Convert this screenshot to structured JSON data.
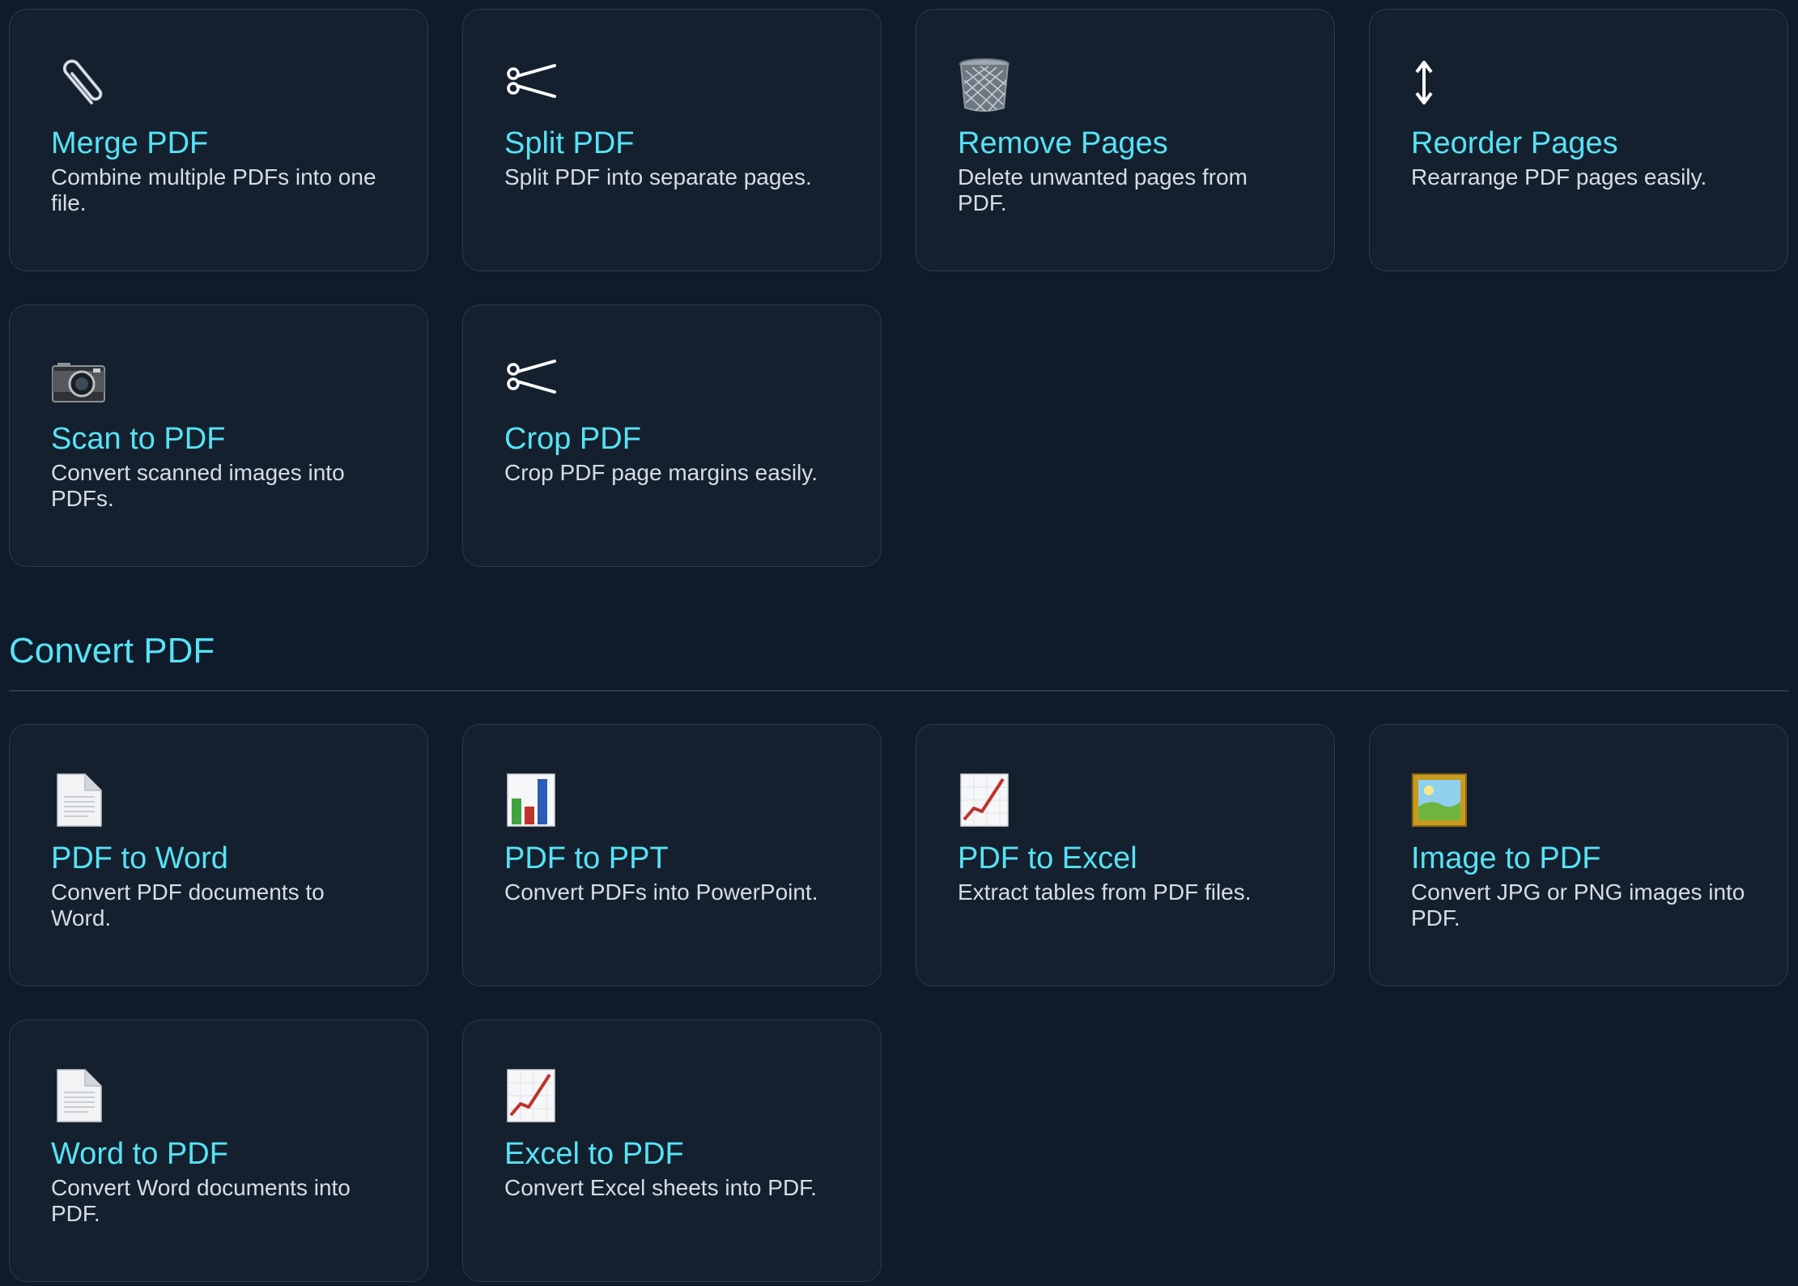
{
  "organize": {
    "cards": [
      {
        "title": "Merge PDF",
        "description": "Combine multiple PDFs into one file.",
        "icon": "paperclip-icon"
      },
      {
        "title": "Split PDF",
        "description": "Split PDF into separate pages.",
        "icon": "scissors-icon"
      },
      {
        "title": "Remove Pages",
        "description": "Delete unwanted pages from PDF.",
        "icon": "wastebasket-icon"
      },
      {
        "title": "Reorder Pages",
        "description": "Rearrange PDF pages easily.",
        "icon": "up-down-arrow-icon"
      },
      {
        "title": "Scan to PDF",
        "description": "Convert scanned images into PDFs.",
        "icon": "camera-icon"
      },
      {
        "title": "Crop PDF",
        "description": "Crop PDF page margins easily.",
        "icon": "scissors-icon"
      }
    ]
  },
  "convert": {
    "heading": "Convert PDF",
    "cards": [
      {
        "title": "PDF to Word",
        "description": "Convert PDF documents to Word.",
        "icon": "document-icon"
      },
      {
        "title": "PDF to PPT",
        "description": "Convert PDFs into PowerPoint.",
        "icon": "bar-chart-icon"
      },
      {
        "title": "PDF to Excel",
        "description": "Extract tables from PDF files.",
        "icon": "chart-increasing-icon"
      },
      {
        "title": "Image to PDF",
        "description": "Convert JPG or PNG images into PDF.",
        "icon": "framed-picture-icon"
      },
      {
        "title": "Word to PDF",
        "description": "Convert Word documents into PDF.",
        "icon": "document-icon"
      },
      {
        "title": "Excel to PDF",
        "description": "Convert Excel sheets into PDF.",
        "icon": "chart-increasing-icon"
      }
    ]
  },
  "colors": {
    "background": "#0f1b2a",
    "card": "#15202f",
    "accent": "#56e3f4",
    "text": "#d5dde6"
  }
}
